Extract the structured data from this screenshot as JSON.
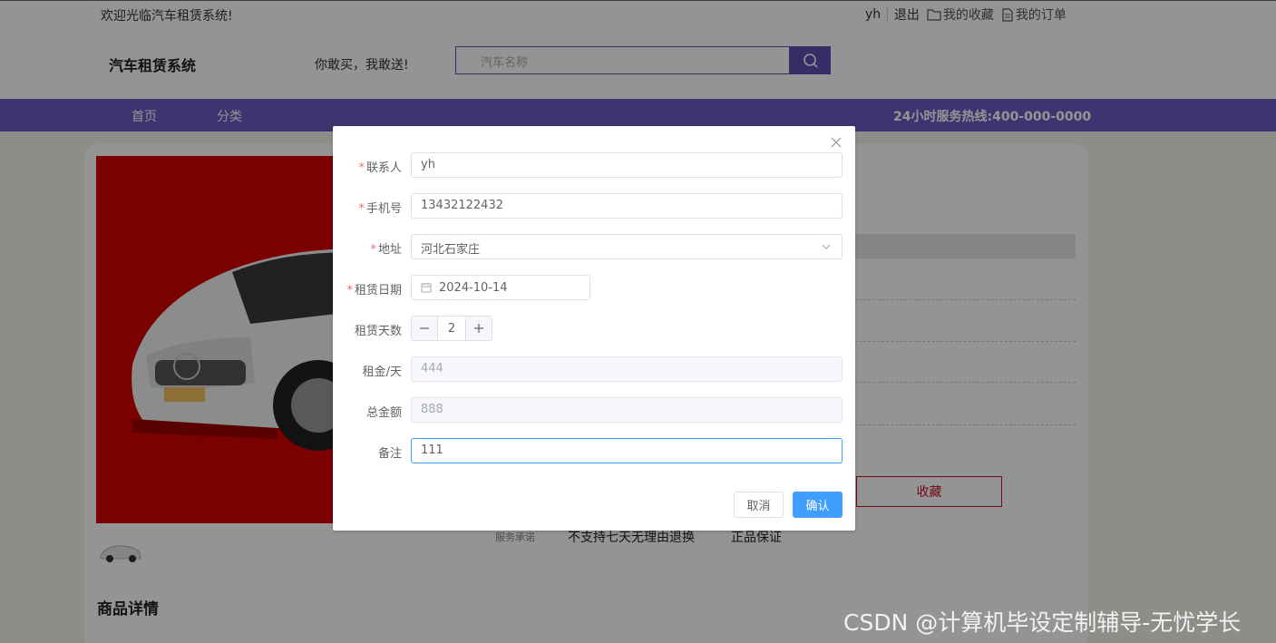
{
  "topbar": {
    "welcome": "欢迎光临汽车租赁系统!",
    "user": "yh",
    "logout": "退出",
    "favorites": "我的收藏",
    "orders": "我的订单"
  },
  "header": {
    "logo": "汽车租赁系统",
    "slogan": "你敢买，我敢送!",
    "search_placeholder": "汽车名称"
  },
  "nav": {
    "items": [
      "首页",
      "分类"
    ],
    "hotline": "24小时服务热线:400-000-0000"
  },
  "product": {
    "collect": "收藏",
    "service_label": "服务承诺",
    "service_1": "不支持七天无理由退换",
    "service_2": "正品保证",
    "detail_title": "商品详情"
  },
  "dialog": {
    "fields": {
      "contact": {
        "label": "联系人",
        "value": "yh",
        "required": true
      },
      "phone": {
        "label": "手机号",
        "value": "13432122432",
        "required": true
      },
      "address": {
        "label": "地址",
        "value": "河北石家庄",
        "required": true
      },
      "date": {
        "label": "租赁日期",
        "value": "2024-10-14",
        "required": true
      },
      "days": {
        "label": "租赁天数",
        "value": "2"
      },
      "rent": {
        "label": "租金/天",
        "value": "444"
      },
      "total": {
        "label": "总金额",
        "value": "888"
      },
      "note": {
        "label": "备注",
        "value": "111"
      }
    },
    "cancel": "取消",
    "confirm": "确认"
  },
  "watermark": "CSDN @计算机毕设定制辅导-无忧学长",
  "colors": {
    "nav": "#6a5cc2",
    "primary": "#409eff",
    "required": "#f56c6c",
    "collect": "#c8102e"
  }
}
